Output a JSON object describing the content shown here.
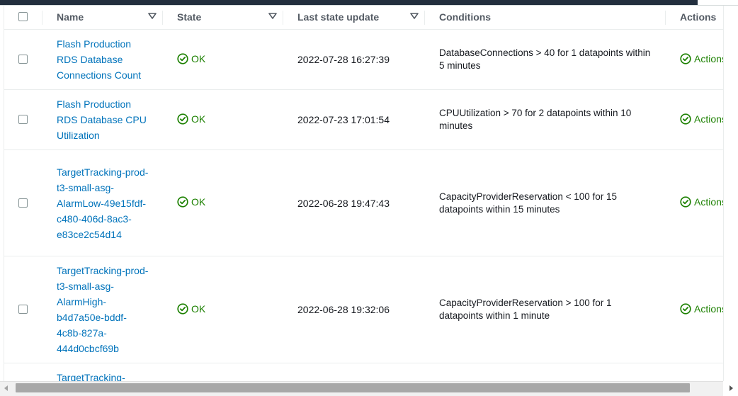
{
  "table": {
    "headers": {
      "name": "Name",
      "state": "State",
      "last_update": "Last state update",
      "conditions": "Conditions",
      "actions": "Actions"
    },
    "rows": [
      {
        "name": "Flash Production RDS Database Connections Count",
        "state": "OK",
        "last_update": "2022-07-28 16:27:39",
        "conditions": "DatabaseConnections > 40 for 1 datapoints within 5 minutes",
        "actions": "Actions enabled"
      },
      {
        "name": "Flash Production RDS Database CPU Utilization",
        "state": "OK",
        "last_update": "2022-07-23 17:01:54",
        "conditions": "CPUUtilization > 70 for 2 datapoints within 10 minutes",
        "actions": "Actions enabled"
      },
      {
        "name": "TargetTracking-prod-t3-small-asg-AlarmLow-49e15fdf-c480-406d-8ac3-e83ce2c54d14",
        "state": "OK",
        "last_update": "2022-06-28 19:47:43",
        "conditions": "CapacityProviderReservation < 100 for 15 datapoints within 15 minutes",
        "actions": "Actions enabled"
      },
      {
        "name": "TargetTracking-prod-t3-small-asg-AlarmHigh-b4d7a50e-bddf-4c8b-827a-444d0cbcf69b",
        "state": "OK",
        "last_update": "2022-06-28 19:32:06",
        "conditions": "CapacityProviderReservation > 100 for 1 datapoints within 1 minute",
        "actions": "Actions enabled"
      },
      {
        "name": "TargetTracking-",
        "state": "",
        "last_update": "",
        "conditions": "",
        "actions": ""
      }
    ]
  },
  "colors": {
    "link": "#0073bb",
    "ok": "#1d8102",
    "header_text": "#545b64",
    "border": "#eaeded"
  },
  "icons": {
    "state_ok": "status-positive-icon",
    "sort": "caret-down-icon"
  }
}
